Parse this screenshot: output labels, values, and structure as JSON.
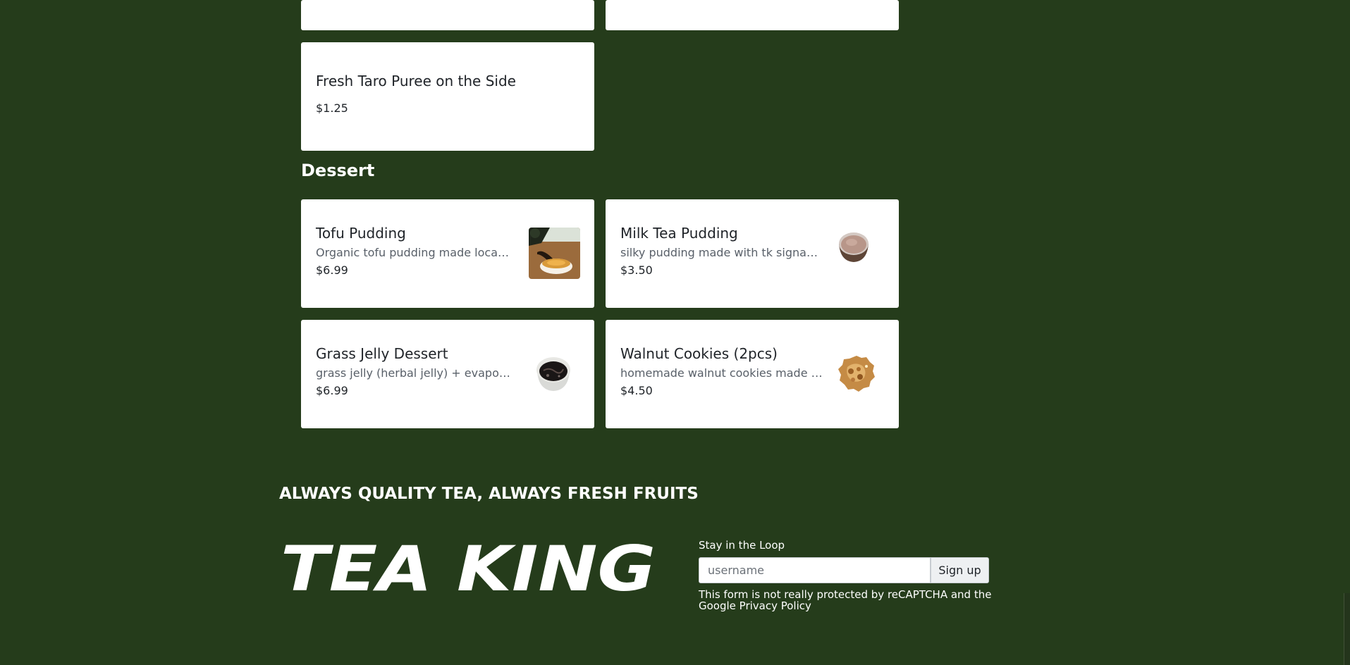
{
  "previous_items": {
    "taro": {
      "name": "Fresh Taro Puree on the Side",
      "price": "$1.25"
    }
  },
  "section": {
    "title": "Dessert"
  },
  "dessert": {
    "items": [
      {
        "name": "Tofu Pudding",
        "desc": "Organic tofu pudding made locally.",
        "price": "$6.99",
        "image_alt": "tofu-pudding-photo"
      },
      {
        "name": "Milk Tea Pudding",
        "desc": "silky pudding made with tk signatur...",
        "price": "$3.50",
        "image_alt": "milk-tea-pudding-photo"
      },
      {
        "name": "Grass Jelly Dessert",
        "desc": "grass jelly (herbal jelly) + evaporate...",
        "price": "$6.99",
        "image_alt": "grass-jelly-dessert-photo"
      },
      {
        "name": "Walnut Cookies (2pcs)",
        "desc": "homemade walnut cookies made fro...",
        "price": "$4.50",
        "image_alt": "walnut-cookies-photo"
      }
    ]
  },
  "footer": {
    "tagline": "ALWAYS QUALITY TEA, ALWAYS FRESH FRUITS",
    "brand_text": "TEA KING",
    "newsletter": {
      "label": "Stay in the Loop",
      "placeholder": "username",
      "button_label": "Sign up",
      "note": "This form is not really protected by reCAPTCHA and the Google Privacy Policy"
    }
  },
  "colors": {
    "background": "#253c1b",
    "card": "#ffffff",
    "text_dark": "#1f2328",
    "text_muted": "#596069"
  }
}
